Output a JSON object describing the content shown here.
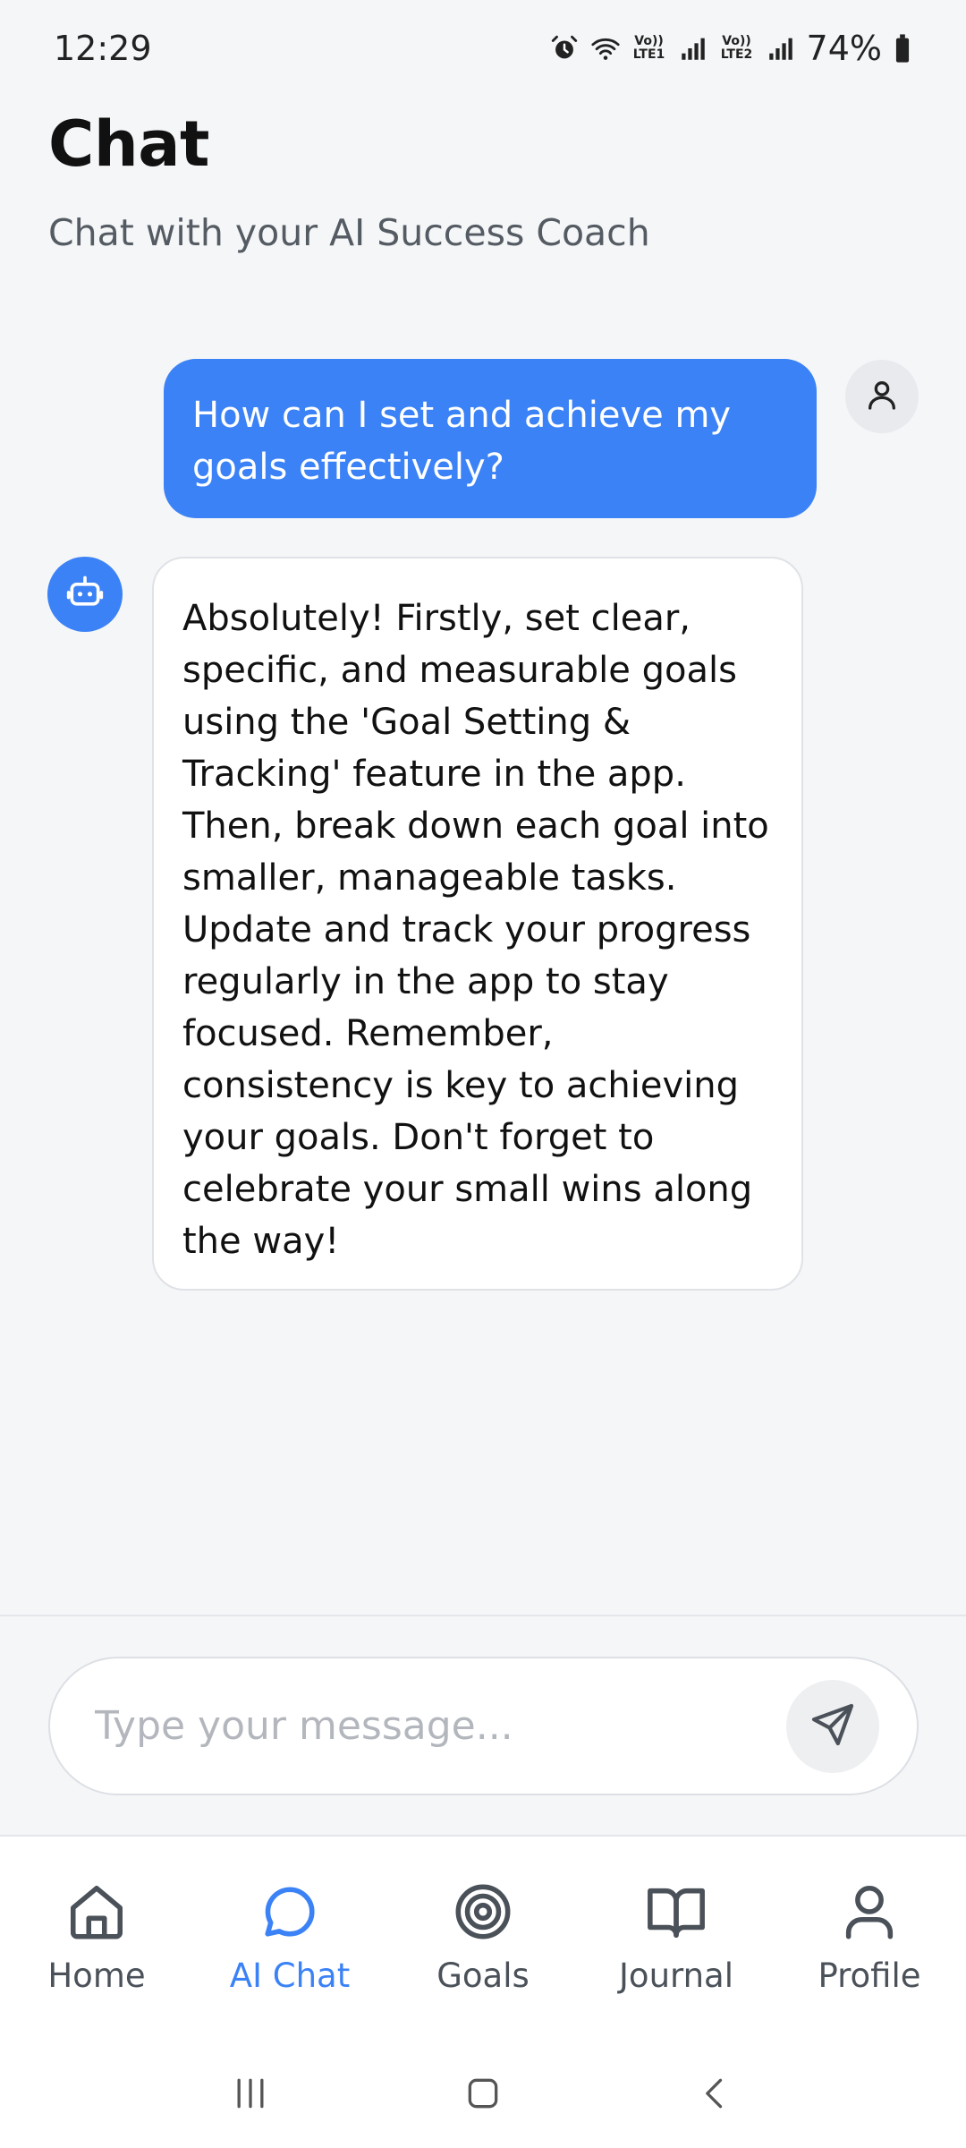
{
  "status_bar": {
    "time": "12:29",
    "battery": "74%",
    "sim1_label": "Vo)) LTE1",
    "sim2_label": "Vo)) LTE2"
  },
  "header": {
    "title": "Chat",
    "subtitle": "Chat with your AI Success Coach"
  },
  "messages": [
    {
      "sender": "user",
      "text": "How can I set and achieve my goals effectively?"
    },
    {
      "sender": "bot",
      "text": "Absolutely! Firstly, set clear, specific, and measurable goals using the 'Goal Setting & Tracking' feature in the app. Then, break down each goal into smaller, manageable tasks. Update and track your progress regularly in the app to stay focused. Remember, consistency is key to achieving your goals. Don't forget to celebrate your small wins along the way!"
    }
  ],
  "composer": {
    "placeholder": "Type your message...",
    "value": ""
  },
  "nav": {
    "items": [
      {
        "label": "Home",
        "icon": "home-icon",
        "active": false
      },
      {
        "label": "AI Chat",
        "icon": "chat-bubble-icon",
        "active": true
      },
      {
        "label": "Goals",
        "icon": "target-icon",
        "active": false
      },
      {
        "label": "Journal",
        "icon": "book-icon",
        "active": false
      },
      {
        "label": "Profile",
        "icon": "person-icon",
        "active": false
      }
    ]
  },
  "colors": {
    "accent": "#3b82f6",
    "background": "#f5f6f8",
    "inactive_nav": "#4b5159"
  }
}
